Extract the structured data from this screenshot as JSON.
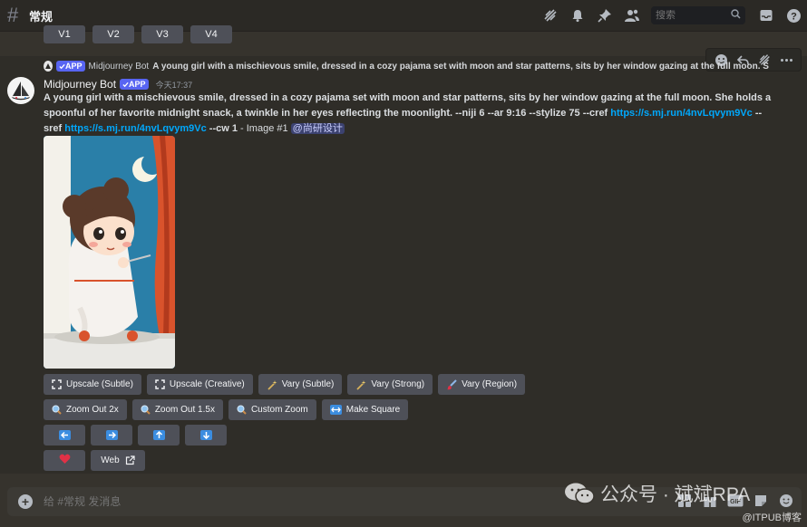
{
  "channel": {
    "name": "常规"
  },
  "search": {
    "placeholder": "搜索"
  },
  "variation_buttons": [
    "V1",
    "V2",
    "V3",
    "V4"
  ],
  "message": {
    "reply": {
      "badge": "APP",
      "author": "Midjourney Bot",
      "content": "A young girl with a mischievous smile, dressed in a cozy pajama set with moon and star patterns, sits by her window gazing at the full moon. She holds a"
    },
    "author": "Midjourney Bot",
    "badge": "APP",
    "timestamp": "今天17:37",
    "prompt_text": "A young girl with a mischievous smile, dressed in a cozy pajama set with moon and star patterns, sits by her window gazing at the full moon. She holds a spoonful of her favorite midnight snack, a twinkle in her eyes reflecting the moonlight. --niji 6 --ar 9:16 --stylize 75 --cref ",
    "cref_link": "https://s.mj.run/4nvLqvym9Vc",
    "sref_prefix": " --sref ",
    "sref_link": "https://s.mj.run/4nvLqvym9Vc",
    "cw_text": " --cw 1",
    "image_label": " - Image #1 ",
    "mention": "@尚研设计"
  },
  "actions": {
    "row1": [
      "Upscale (Subtle)",
      "Upscale (Creative)",
      "Vary (Subtle)",
      "Vary (Strong)",
      "Vary (Region)"
    ],
    "row2": [
      "Zoom Out 2x",
      "Zoom Out 1.5x",
      "Custom Zoom",
      "Make Square"
    ],
    "web": "Web"
  },
  "composer": {
    "placeholder": "给 #常规 发消息"
  },
  "watermark": {
    "text": "公众号 · 斌斌RPA",
    "sub": "@ITPUB博客"
  },
  "colors": {
    "accent": "#5865f2",
    "link": "#00a8fc",
    "button": "#4e5058",
    "arrow": "#3b8de0",
    "heart": "#e03146"
  }
}
